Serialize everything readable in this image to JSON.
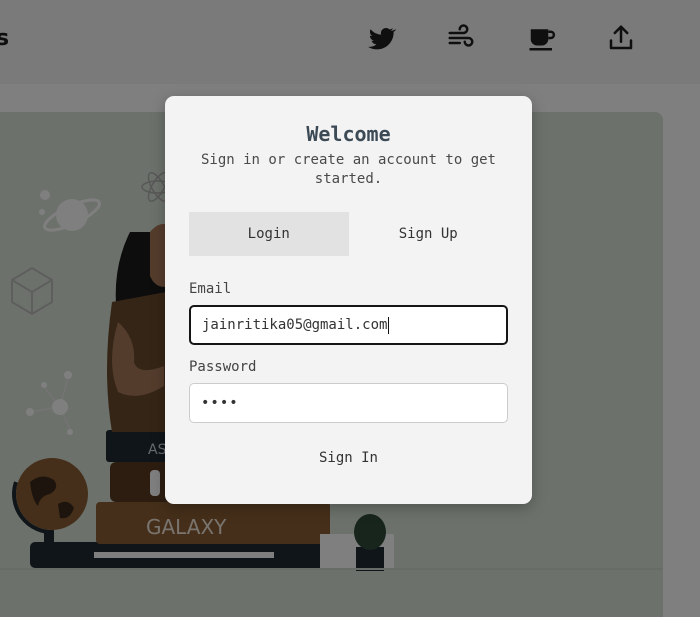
{
  "header": {
    "brand_text": "s",
    "icons": [
      "twitter-bird-icon",
      "wind-icon",
      "coffee-cup-icon",
      "upload-share-icon"
    ]
  },
  "hero": {
    "book_spine_text": "GALAXY",
    "book_spine_partial": "AS"
  },
  "modal": {
    "title": "Welcome",
    "subtitle": "Sign in or create an account to get started.",
    "tabs": [
      {
        "label": "Login",
        "active": true
      },
      {
        "label": "Sign Up",
        "active": false
      }
    ],
    "email": {
      "label": "Email",
      "value": "jainritika05@gmail.com"
    },
    "password": {
      "label": "Password",
      "value": "••••"
    },
    "submit_label": "Sign In"
  },
  "colors": {
    "overlay": "#808080",
    "modal_bg": "#f3f3f3",
    "hero_bg": "#d9e3d6",
    "title_color": "#3c4a55"
  }
}
